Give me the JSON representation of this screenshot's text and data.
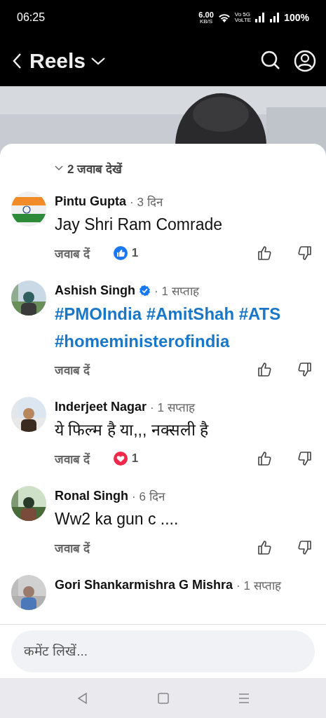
{
  "status_bar": {
    "time": "06:25",
    "speed": "6.00",
    "speed_unit": "KB/S",
    "network_top": "Vo 5G",
    "network_bottom": "VoLTE",
    "battery": "100%"
  },
  "header": {
    "title": "Reels"
  },
  "replies_toggle": {
    "label": "2 जवाब देखें"
  },
  "comments": [
    {
      "name": "Pintu Gupta",
      "time": "· 3 दिन",
      "kind": "text",
      "lines": [
        "Jay Shri Ram Comrade"
      ],
      "reply": "जवाब दें",
      "reaction": {
        "kind": "like",
        "count": "1"
      }
    },
    {
      "name": "Ashish Singh",
      "verified": true,
      "time": "· 1 सप्ताह",
      "kind": "hashtags",
      "lines": [
        "#PMOIndia #AmitShah #ATS",
        "#homeministerofindia"
      ],
      "reply": "जवाब दें"
    },
    {
      "name": "Inderjeet Nagar",
      "time": "· 1 सप्ताह",
      "kind": "text",
      "lines": [
        "ये फिल्म है या,,, नक्सली है"
      ],
      "reply": "जवाब दें",
      "reaction": {
        "kind": "love",
        "count": "1"
      }
    },
    {
      "name": "Ronal Singh",
      "time": "· 6 दिन",
      "kind": "text",
      "lines": [
        "Ww2 ka gun c ...."
      ],
      "reply": "जवाब दें"
    },
    {
      "name": "Gori Shankarmishra G Mishra",
      "time": "· 1 सप्ताह"
    }
  ],
  "composer": {
    "placeholder": "कमेंट लिखें..."
  }
}
